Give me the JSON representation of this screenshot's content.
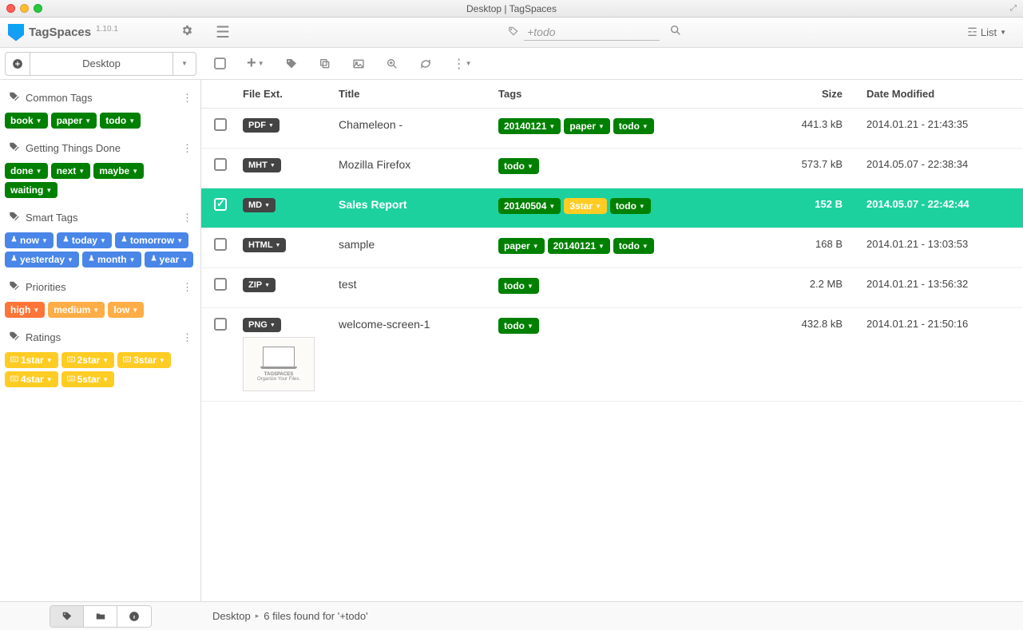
{
  "window": {
    "title": "Desktop | TagSpaces"
  },
  "app": {
    "name": "TagSpaces",
    "version": "1.10.1"
  },
  "location": {
    "name": "Desktop"
  },
  "search": {
    "value": "+todo"
  },
  "view": {
    "label": "List"
  },
  "sidebar": {
    "groups": [
      {
        "title": "Common Tags",
        "tags": [
          {
            "label": "book",
            "color": "green"
          },
          {
            "label": "paper",
            "color": "green"
          },
          {
            "label": "todo",
            "color": "green"
          }
        ]
      },
      {
        "title": "Getting Things Done",
        "tags": [
          {
            "label": "done",
            "color": "green"
          },
          {
            "label": "next",
            "color": "green"
          },
          {
            "label": "maybe",
            "color": "green"
          },
          {
            "label": "waiting",
            "color": "green"
          }
        ]
      },
      {
        "title": "Smart Tags",
        "tags": [
          {
            "label": "now",
            "color": "blue",
            "icon": "flask"
          },
          {
            "label": "today",
            "color": "blue",
            "icon": "flask"
          },
          {
            "label": "tomorrow",
            "color": "blue",
            "icon": "flask"
          },
          {
            "label": "yesterday",
            "color": "blue",
            "icon": "flask"
          },
          {
            "label": "month",
            "color": "blue",
            "icon": "flask"
          },
          {
            "label": "year",
            "color": "blue",
            "icon": "flask"
          }
        ]
      },
      {
        "title": "Priorities",
        "tags": [
          {
            "label": "high",
            "color": "orange"
          },
          {
            "label": "medium",
            "color": "yellow"
          },
          {
            "label": "low",
            "color": "yellow"
          }
        ]
      },
      {
        "title": "Ratings",
        "tags": [
          {
            "label": "1star",
            "color": "star-yellow",
            "icon": "keyboard"
          },
          {
            "label": "2star",
            "color": "star-yellow",
            "icon": "keyboard"
          },
          {
            "label": "3star",
            "color": "star-yellow",
            "icon": "keyboard"
          },
          {
            "label": "4star",
            "color": "star-yellow",
            "icon": "keyboard"
          },
          {
            "label": "5star",
            "color": "star-yellow",
            "icon": "keyboard"
          }
        ]
      }
    ]
  },
  "table": {
    "headers": {
      "ext": "File Ext.",
      "title": "Title",
      "tags": "Tags",
      "size": "Size",
      "date": "Date Modified"
    },
    "rows": [
      {
        "ext": "PDF",
        "title": "Chameleon -",
        "tags": [
          {
            "label": "20140121",
            "color": "green"
          },
          {
            "label": "paper",
            "color": "green"
          },
          {
            "label": "todo",
            "color": "green"
          }
        ],
        "size": "441.3 kB",
        "date": "2014.01.21 - 21:43:35",
        "selected": false
      },
      {
        "ext": "MHT",
        "title": "Mozilla Firefox",
        "tags": [
          {
            "label": "todo",
            "color": "green"
          }
        ],
        "size": "573.7 kB",
        "date": "2014.05.07 - 22:38:34",
        "selected": false
      },
      {
        "ext": "MD",
        "title": "Sales Report",
        "tags": [
          {
            "label": "20140504",
            "color": "green"
          },
          {
            "label": "3star",
            "color": "star-yellow"
          },
          {
            "label": "todo",
            "color": "green"
          }
        ],
        "size": "152 B",
        "date": "2014.05.07 - 22:42:44",
        "selected": true
      },
      {
        "ext": "HTML",
        "title": "sample",
        "tags": [
          {
            "label": "paper",
            "color": "green"
          },
          {
            "label": "20140121",
            "color": "green"
          },
          {
            "label": "todo",
            "color": "green"
          }
        ],
        "size": "168 B",
        "date": "2014.01.21 - 13:03:53",
        "selected": false
      },
      {
        "ext": "ZIP",
        "title": "test",
        "tags": [
          {
            "label": "todo",
            "color": "green"
          }
        ],
        "size": "2.2 MB",
        "date": "2014.01.21 - 13:56:32",
        "selected": false
      },
      {
        "ext": "PNG",
        "title": "welcome-screen-1",
        "tags": [
          {
            "label": "todo",
            "color": "green"
          }
        ],
        "size": "432.8 kB",
        "date": "2014.01.21 - 21:50:16",
        "selected": false,
        "thumb": true,
        "thumb_text1": "TAGSPACES",
        "thumb_text2": "Organize Your Files."
      }
    ]
  },
  "footer": {
    "location": "Desktop",
    "status": "6 files found for '+todo'"
  }
}
